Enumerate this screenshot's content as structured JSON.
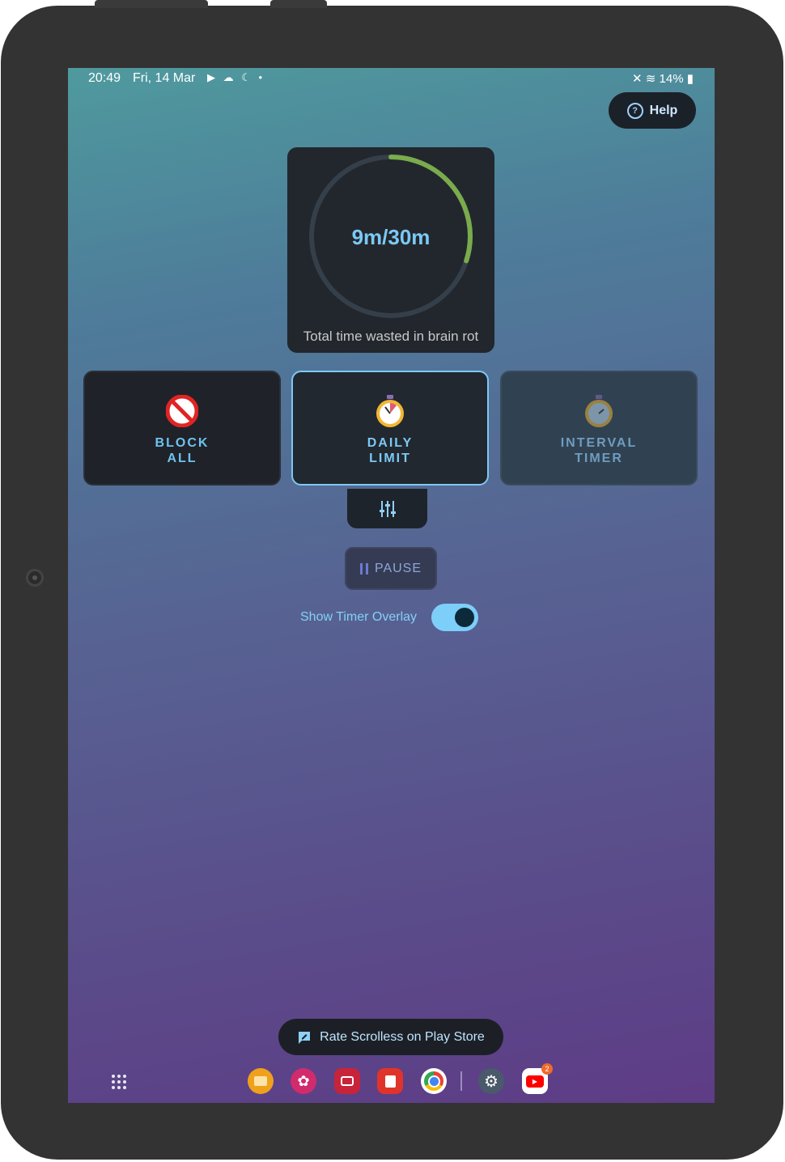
{
  "status_bar": {
    "time": "20:49",
    "date": "Fri, 14 Mar",
    "notification_icons": [
      "youtube-icon",
      "cloud-icon",
      "moon-icon",
      "dot-icon"
    ],
    "battery": "14%",
    "right_icons": [
      "mute-icon",
      "wifi-icon",
      "battery-icon"
    ]
  },
  "help_button": {
    "label": "Help"
  },
  "timer": {
    "value": "9m/30m",
    "caption": "Total time wasted in brain rot",
    "progress_fraction": 0.3,
    "progress_color": "#7aab4c",
    "track_color": "#343f4a"
  },
  "modes": [
    {
      "id": "block",
      "line1": "BLOCK",
      "line2": "ALL",
      "icon": "prohibited-icon",
      "selected": false
    },
    {
      "id": "daily",
      "line1": "DAILY",
      "line2": "LIMIT",
      "icon": "stopwatch-icon",
      "selected": true
    },
    {
      "id": "interval",
      "line1": "INTERVAL",
      "line2": "TIMER",
      "icon": "stopwatch-icon",
      "selected": false
    }
  ],
  "settings_button": {
    "icon": "sliders-icon"
  },
  "pause_button": {
    "label": "PAUSE",
    "icon": "pause-icon"
  },
  "overlay_toggle": {
    "label": "Show Timer Overlay",
    "on": true
  },
  "rate_button": {
    "label": "Rate Scrolless on Play Store",
    "icon": "rate-review-icon"
  },
  "dock": {
    "apps": [
      "my-files-icon",
      "gallery-icon",
      "camera-icon",
      "notes-icon",
      "chrome-icon",
      "settings-icon",
      "youtube-icon"
    ],
    "youtube_badge": "2"
  },
  "colors": {
    "accent": "#7cc9f5",
    "card": "#22272d"
  }
}
